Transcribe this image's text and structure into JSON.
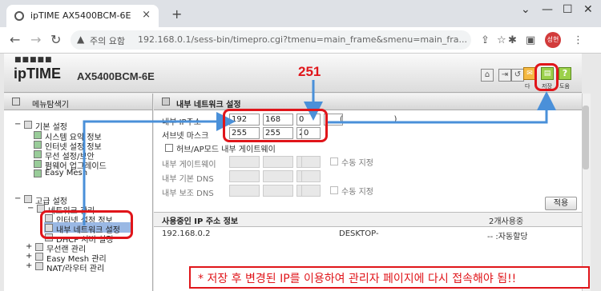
{
  "browser": {
    "tab_title": "ipTIME AX5400BCM-6E",
    "tab_close": "×",
    "new_tab": "+",
    "security_warning": "주의 요함",
    "url": "192.168.0.1/sess-bin/timepro.cgi?tmenu=main_frame&smenu=main_fra...",
    "profile_label": "성현"
  },
  "router": {
    "logo_dots": "■■■■■",
    "logo": "ipTIME",
    "model": "AX5400BCM-6E",
    "header_buttons": {
      "mail_label": "다",
      "save_label": "저장",
      "help_label": "도움"
    }
  },
  "sidebar": {
    "title": "메뉴탐색기",
    "groups": [
      {
        "label": "기본 설정",
        "items": [
          "시스템 요약 정보",
          "인터넷 설정 정보",
          "무선 설정/보안",
          "펌웨어 업그레이드",
          "Easy Mesh"
        ]
      },
      {
        "label": "고급 설정",
        "subgroup": "네트워크 관리",
        "items": [
          "인터넷 설정 정보",
          "내부 네트워크 설정",
          "DHCP 서버 설정"
        ],
        "more": [
          "무선랜 관리",
          "Easy Mesh 관리",
          "NAT/라우터 관리"
        ]
      }
    ]
  },
  "panel": {
    "title": "내부 네트워크 설정",
    "ip_label": "내부 IP주소",
    "ip": [
      "192",
      "168",
      "0",
      ""
    ],
    "ip_note": "(                    )",
    "mask_label": "서브넷 마스크",
    "mask": [
      "255",
      "255",
      "255",
      "0"
    ],
    "hub_ap_label": "허브/AP모드 내부 게이트웨이",
    "gateway_label": "내부 게이트웨이",
    "dns1_label": "내부 기본 DNS",
    "dns2_label": "내부 보조 DNS",
    "manual_label": "수동 지정",
    "apply_label": "적용",
    "ipinfo_title": "사용중인 IP 주소 정보",
    "ipinfo_count": "2개사용중",
    "ipinfo_row": {
      "ip": "192.168.0.2",
      "name": "DESKTOP-",
      "type": "-- :자동할당"
    }
  },
  "annotation": {
    "number": "251",
    "notice": "* 저장 후 변경된 IP를 이용하여 관리자 페이지에 다시 접속해야 됨!!",
    "color": "#e0151a",
    "arrow_color": "#4a90d9"
  }
}
